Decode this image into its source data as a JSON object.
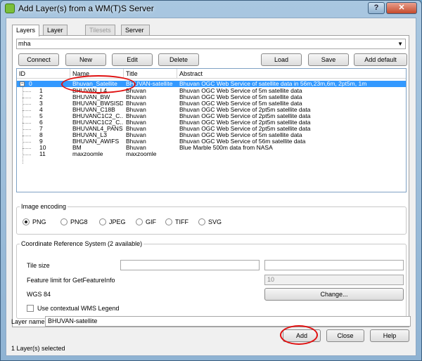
{
  "window": {
    "title": "Add Layer(s) from a WM(T)S Server",
    "help_label": "?",
    "close_label": "✕"
  },
  "tabs": [
    {
      "label": "Layers"
    },
    {
      "label": "Layer Order"
    },
    {
      "label": "Tilesets"
    },
    {
      "label": "Server Search"
    }
  ],
  "connection": {
    "selected": "mha",
    "dropdown_icon": "▼",
    "connect_label": "Connect",
    "new_label": "New",
    "edit_label": "Edit",
    "delete_label": "Delete",
    "load_label": "Load",
    "save_label": "Save",
    "add_default_label": "Add default servers"
  },
  "layer_tree": {
    "columns": [
      "ID",
      "Name",
      "Title",
      "Abstract"
    ],
    "rows": [
      {
        "id": "0",
        "name": "Bhuvan_Satellite",
        "title": "BHUVAN-satellite",
        "abstract": "Bhuvan OGC Web Service of satellite data in 56m,23m,6m, 2pt5m, 1m",
        "expander": "−"
      },
      {
        "id": "1",
        "name": "BHUVAN_L4",
        "title": "Bhuvan",
        "abstract": "Bhuvan OGC Web Service of 5m satellite data"
      },
      {
        "id": "2",
        "name": "BHUVAN_BW",
        "title": "Bhuvan",
        "abstract": "Bhuvan OGC Web Service of 5m satellite data"
      },
      {
        "id": "3",
        "name": "BHUVAN_BWSISDP",
        "title": "Bhuvan",
        "abstract": "Bhuvan OGC Web Service of 5m satellite data"
      },
      {
        "id": "4",
        "name": "BHUVAN_C18B",
        "title": "Bhuvan",
        "abstract": "Bhuvan OGC Web Service of 2pt5m satellite data"
      },
      {
        "id": "5",
        "name": "BHUVANC1C2_C...",
        "title": "Bhuvan",
        "abstract": "Bhuvan OGC Web Service of 2pt5m satellite data"
      },
      {
        "id": "6",
        "name": "BHUVANC1C2_C...",
        "title": "Bhuvan",
        "abstract": "Bhuvan OGC Web Service of 2pt5m satellite data"
      },
      {
        "id": "7",
        "name": "BHUVANL4_PANS...",
        "title": "Bhuvan",
        "abstract": "Bhuvan OGC Web Service of 2pt5m satellite data"
      },
      {
        "id": "8",
        "name": "BHUVAN_L3",
        "title": "Bhuvan",
        "abstract": "Bhuvan OGC Web Service of 5m satellite data"
      },
      {
        "id": "9",
        "name": "BHUVAN_AWIFS",
        "title": "Bhuvan",
        "abstract": "Bhuvan OGC Web Service of 56m satellite data"
      },
      {
        "id": "10",
        "name": "BM",
        "title": "Bhuvan",
        "abstract": "Blue Marble 500m data from NASA"
      },
      {
        "id": "11",
        "name": "maxzoomle",
        "title": "maxzoomle",
        "abstract": ""
      }
    ]
  },
  "image_encoding": {
    "title": "Image encoding",
    "options": [
      "PNG",
      "PNG8",
      "JPEG",
      "GIF",
      "TIFF",
      "SVG"
    ],
    "selected": "PNG"
  },
  "crs": {
    "title": "Coordinate Reference System (2 available)",
    "tile_size_label": "Tile size",
    "tile_width": "",
    "tile_height": "",
    "feature_limit_label": "Feature limit for GetFeatureInfo",
    "feature_limit": "10",
    "crs_value": "WGS 84",
    "change_label": "Change...",
    "contextual_legend_label": "Use contextual WMS Legend"
  },
  "layer_name": {
    "label": "Layer name",
    "value": "BHUVAN-satellite"
  },
  "buttons": {
    "add": "Add",
    "close": "Close",
    "help": "Help"
  },
  "status": "1 Layer(s) selected",
  "colors": {
    "selection": "#3399ff",
    "annotation": "#e01010"
  }
}
